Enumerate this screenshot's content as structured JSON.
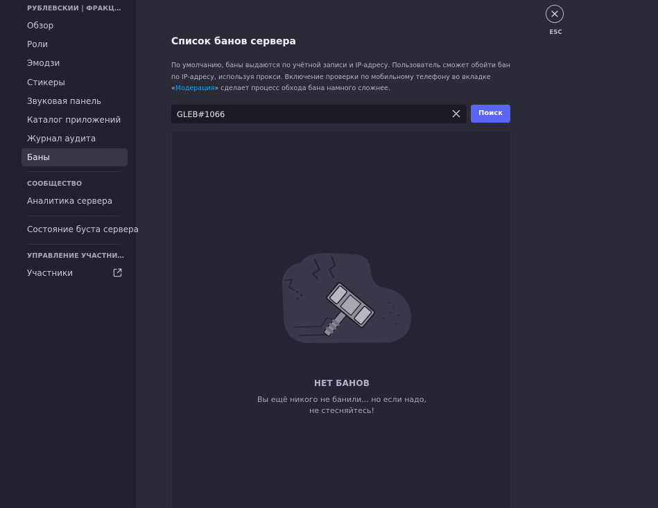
{
  "sidebar": {
    "server_section": "РУБЛЕВСКИЙ | ФРАКЦИИ",
    "items": [
      {
        "label": "Обзор"
      },
      {
        "label": "Роли"
      },
      {
        "label": "Эмодзи"
      },
      {
        "label": "Стикеры"
      },
      {
        "label": "Звуковая панель"
      },
      {
        "label": "Каталог приложений"
      },
      {
        "label": "Журнал аудита"
      },
      {
        "label": "Баны"
      }
    ],
    "active_item": "Баны",
    "community_section": "СООБЩЕСТВО",
    "analytics_label": "Аналитика сервера",
    "boost_label": "Состояние буста сервера",
    "members_section": "УПРАВЛЕНИЕ УЧАСТНИКА...",
    "members_label": "Участники",
    "members_icon": "external-link-icon"
  },
  "main": {
    "title": "Список банов сервера",
    "description_part1": "По умолчанию, баны выдаются по учётной записи и IP-адресу. Пользователь сможет обойти бан по IP-адресу, используя прокси. Включение проверки по мобильному телефону во вкладке «",
    "description_link": "Модерация",
    "description_part2": "» сделает процесс обхода бана намного сложнее.",
    "search": {
      "value": "GLEB#1066",
      "clear_icon": "close-icon",
      "button_label": "Поиск"
    },
    "empty": {
      "illustration_icon": "ban-hammer-icon",
      "title": "НЕТ БАНОВ",
      "subtitle_line1": "Вы ещё никого не банили... но если надо,",
      "subtitle_line2": "не стесняйтесь!"
    }
  },
  "close": {
    "icon": "close-icon",
    "label": "ESC"
  },
  "colors": {
    "background": "#2b2a37",
    "sidebar": "#22212d",
    "accent": "#5865f2",
    "link": "#00a8fc"
  }
}
